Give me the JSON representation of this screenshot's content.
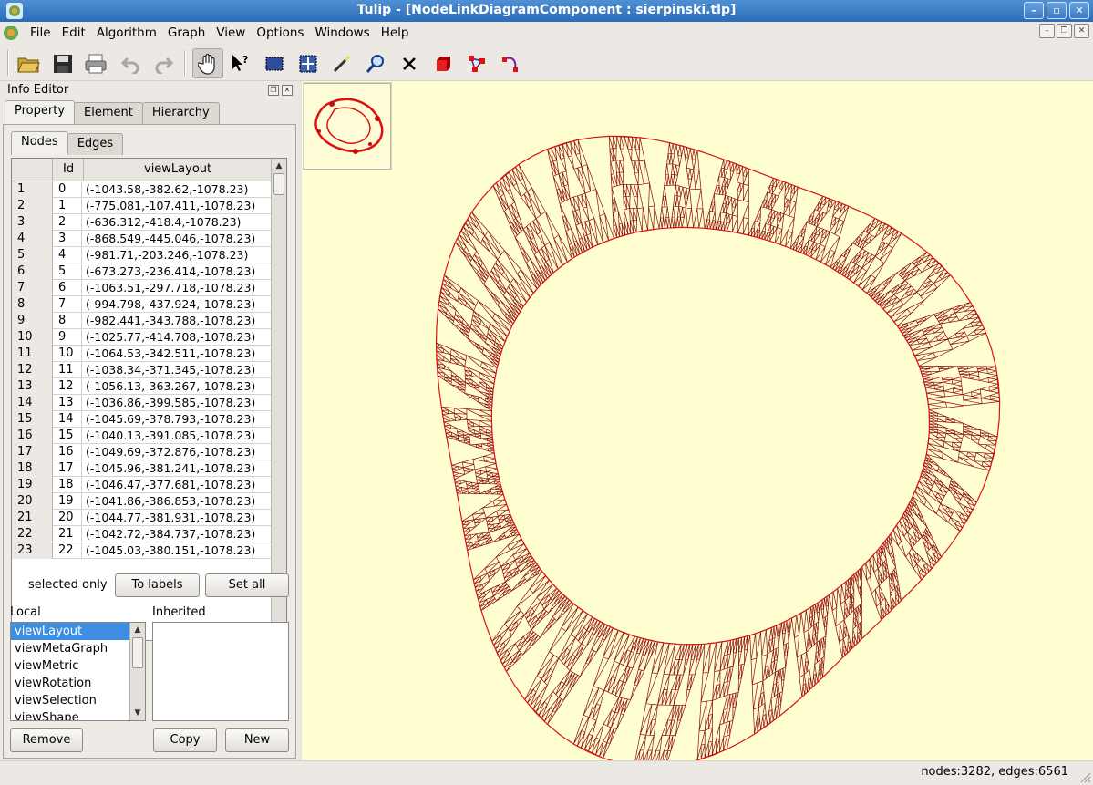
{
  "window": {
    "title": "Tulip - [NodeLinkDiagramComponent : sierpinski.tlp]"
  },
  "menu": [
    "File",
    "Edit",
    "Algorithm",
    "Graph",
    "View",
    "Options",
    "Windows",
    "Help"
  ],
  "toolbar": {
    "icons": [
      "open-folder-icon",
      "save-icon",
      "print-icon",
      "undo-icon",
      "redo-icon",
      "pan-hand-icon",
      "what-is-this-icon",
      "rectangle-select-icon",
      "zoom-box-icon",
      "magic-wand-icon",
      "magnify-icon",
      "delete-icon",
      "add-node-icon",
      "add-edge-icon",
      "edit-edge-bend-icon"
    ]
  },
  "info_editor": {
    "title": "Info Editor",
    "tabs": [
      "Property",
      "Element",
      "Hierarchy"
    ],
    "subtabs": [
      "Nodes",
      "Edges"
    ],
    "columns": {
      "id": "Id",
      "prop": "viewLayout"
    },
    "rows": [
      [
        "1",
        "0",
        "(-1043.58,-382.62,-1078.23)"
      ],
      [
        "2",
        "1",
        "(-775.081,-107.411,-1078.23)"
      ],
      [
        "3",
        "2",
        "(-636.312,-418.4,-1078.23)"
      ],
      [
        "4",
        "3",
        "(-868.549,-445.046,-1078.23)"
      ],
      [
        "5",
        "4",
        "(-981.71,-203.246,-1078.23)"
      ],
      [
        "6",
        "5",
        "(-673.273,-236.414,-1078.23)"
      ],
      [
        "7",
        "6",
        "(-1063.51,-297.718,-1078.23)"
      ],
      [
        "8",
        "7",
        "(-994.798,-437.924,-1078.23)"
      ],
      [
        "9",
        "8",
        "(-982.441,-343.788,-1078.23)"
      ],
      [
        "10",
        "9",
        "(-1025.77,-414.708,-1078.23)"
      ],
      [
        "11",
        "10",
        "(-1064.53,-342.511,-1078.23)"
      ],
      [
        "12",
        "11",
        "(-1038.34,-371.345,-1078.23)"
      ],
      [
        "13",
        "12",
        "(-1056.13,-363.267,-1078.23)"
      ],
      [
        "14",
        "13",
        "(-1036.86,-399.585,-1078.23)"
      ],
      [
        "15",
        "14",
        "(-1045.69,-378.793,-1078.23)"
      ],
      [
        "16",
        "15",
        "(-1040.13,-391.085,-1078.23)"
      ],
      [
        "17",
        "16",
        "(-1049.69,-372.876,-1078.23)"
      ],
      [
        "18",
        "17",
        "(-1045.96,-381.241,-1078.23)"
      ],
      [
        "19",
        "18",
        "(-1046.47,-377.681,-1078.23)"
      ],
      [
        "20",
        "19",
        "(-1041.86,-386.853,-1078.23)"
      ],
      [
        "21",
        "20",
        "(-1044.77,-381.931,-1078.23)"
      ],
      [
        "22",
        "21",
        "(-1042.72,-384.737,-1078.23)"
      ],
      [
        "23",
        "22",
        "(-1045.03,-380.151,-1078.23)"
      ]
    ],
    "selected_only_label": "selected only",
    "to_labels": "To labels",
    "set_all": "Set all",
    "local_label": "Local",
    "inherited_label": "Inherited",
    "local_props": [
      "viewLayout",
      "viewMetaGraph",
      "viewMetric",
      "viewRotation",
      "viewSelection",
      "viewShape"
    ],
    "remove": "Remove",
    "copy": "Copy",
    "new": "New"
  },
  "status": "nodes:3282, edges:6561",
  "colors": {
    "canvas_bg": "#fffed1",
    "edge": "#8b0a0a",
    "node": "#e01010",
    "selection": "#3d8ee0"
  }
}
